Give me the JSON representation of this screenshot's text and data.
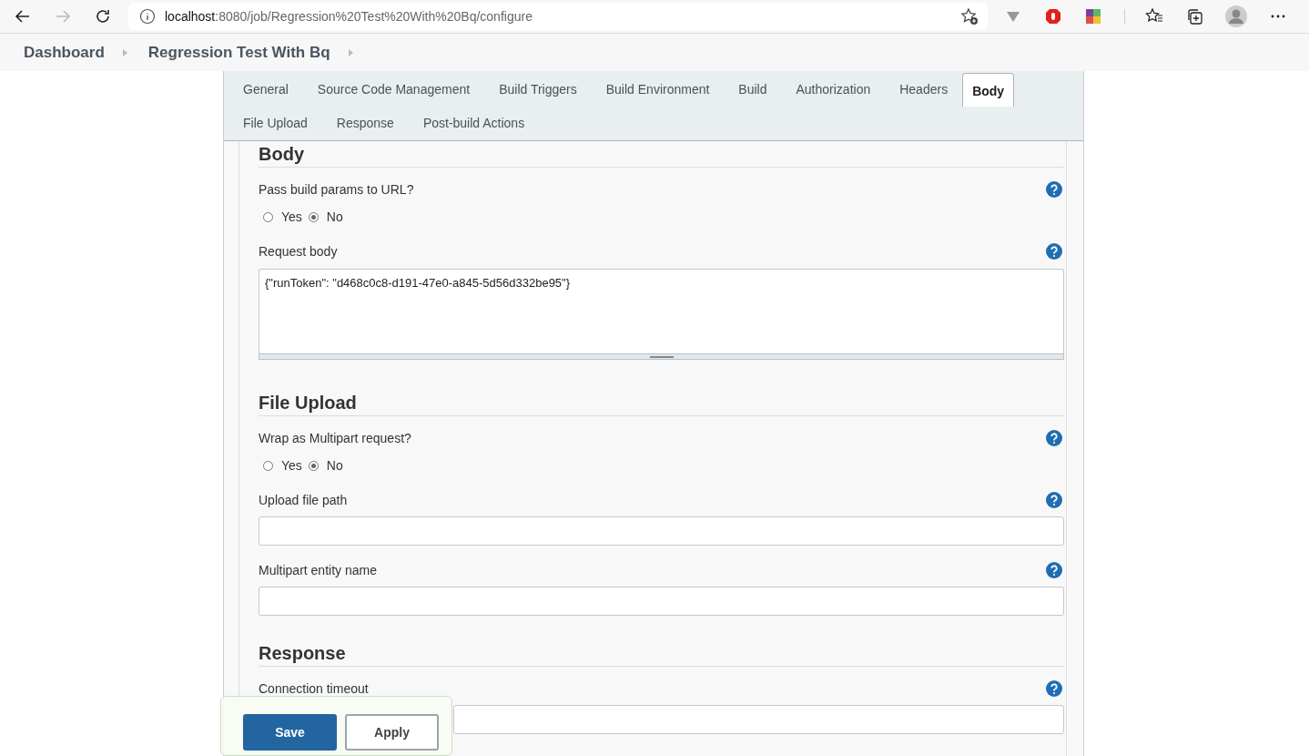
{
  "browser": {
    "url_host": "localhost",
    "url_rest": ":8080/job/Regression%20Test%20With%20Bq/configure"
  },
  "breadcrumbs": [
    "Dashboard",
    "Regression Test With Bq"
  ],
  "tabs": [
    {
      "label": "General",
      "selected": false
    },
    {
      "label": "Source Code Management",
      "selected": false
    },
    {
      "label": "Build Triggers",
      "selected": false
    },
    {
      "label": "Build Environment",
      "selected": false
    },
    {
      "label": "Build",
      "selected": false
    },
    {
      "label": "Authorization",
      "selected": false
    },
    {
      "label": "Headers",
      "selected": false
    },
    {
      "label": "Body",
      "selected": true
    },
    {
      "label": "File Upload",
      "selected": false
    },
    {
      "label": "Response",
      "selected": false
    },
    {
      "label": "Post-build Actions",
      "selected": false
    }
  ],
  "sections": [
    {
      "title": "Body",
      "fields": [
        {
          "kind": "radio",
          "label": "Pass build params to URL?",
          "options": [
            {
              "label": "Yes",
              "selected": false
            },
            {
              "label": "No",
              "selected": true
            }
          ]
        },
        {
          "kind": "textarea",
          "label": "Request body",
          "value": "{\"runToken\": \"d468c0c8-d191-47e0-a845-5d56d332be95\"}"
        }
      ]
    },
    {
      "title": "File Upload",
      "fields": [
        {
          "kind": "radio",
          "label": "Wrap as Multipart request?",
          "options": [
            {
              "label": "Yes",
              "selected": false
            },
            {
              "label": "No",
              "selected": true
            }
          ]
        },
        {
          "kind": "text",
          "label": "Upload file path"
        },
        {
          "kind": "text",
          "label": "Multipart entity name"
        }
      ]
    },
    {
      "title": "Response",
      "fields": [
        {
          "kind": "text",
          "label": "Connection timeout"
        }
      ]
    }
  ],
  "buttons": [
    {
      "label": "Save",
      "kind": "primary"
    },
    {
      "label": "Apply",
      "kind": "secondary"
    }
  ]
}
